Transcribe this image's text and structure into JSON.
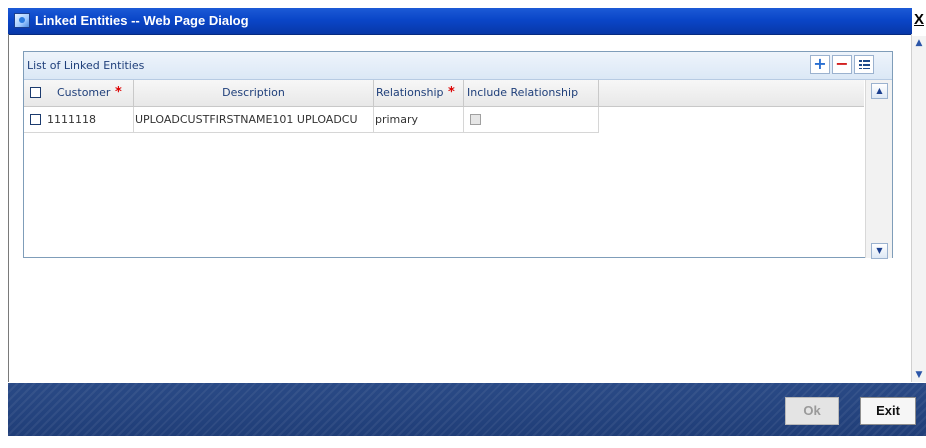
{
  "window": {
    "title": "Linked Entities -- Web Page Dialog",
    "close_label": "X"
  },
  "panel": {
    "caption": "List of Linked Entities"
  },
  "toolbar": {
    "add_label": "+",
    "delete_label": "−"
  },
  "table": {
    "columns": [
      {
        "label": "Customer",
        "required": true
      },
      {
        "label": "Description",
        "required": false
      },
      {
        "label": "Relationship",
        "required": true
      },
      {
        "label": "Include Relationship",
        "required": false
      }
    ],
    "required_marker": "*",
    "rows": [
      {
        "customer": "1111118",
        "description": "UPLOADCUSTFIRSTNAME101 UPLOADCU",
        "relationship": "primary",
        "include_relationship": false
      }
    ]
  },
  "footer": {
    "ok_label": "Ok",
    "exit_label": "Exit"
  },
  "colors": {
    "title_bar": "#0a46c8",
    "footer": "#203e78",
    "required": "#dd0000"
  }
}
